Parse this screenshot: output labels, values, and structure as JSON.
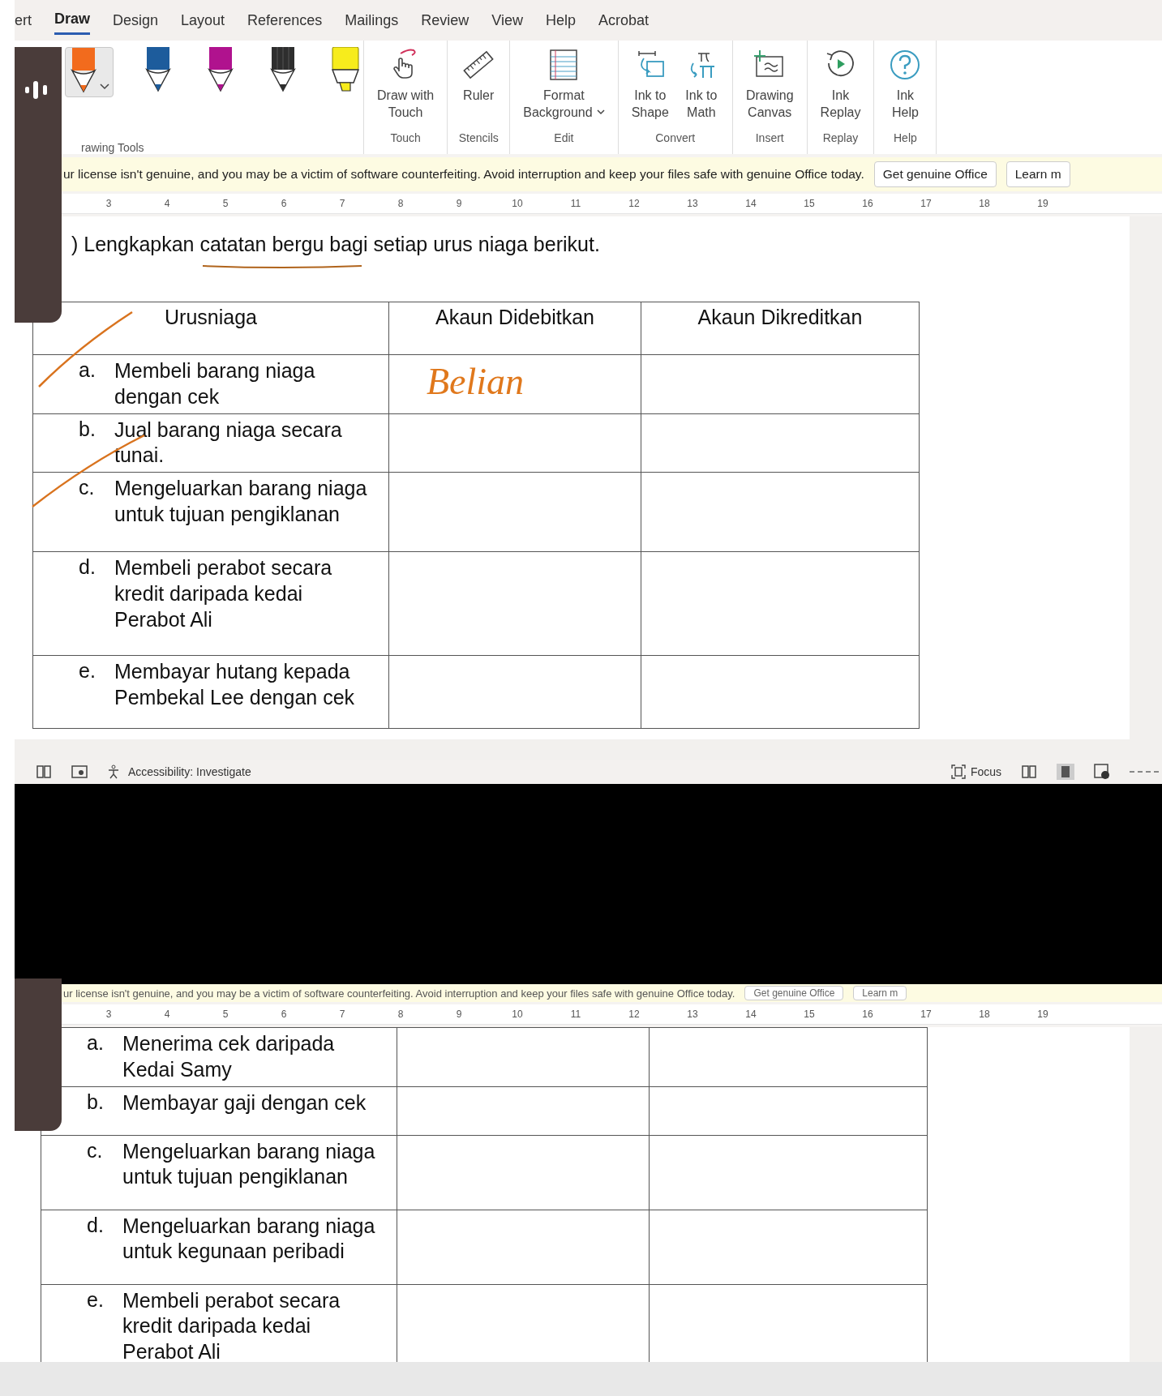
{
  "menu_tabs": [
    {
      "label": "ert",
      "selected": false
    },
    {
      "label": "Draw",
      "selected": true
    },
    {
      "label": "Design",
      "selected": false
    },
    {
      "label": "Layout",
      "selected": false
    },
    {
      "label": "References",
      "selected": false
    },
    {
      "label": "Mailings",
      "selected": false
    },
    {
      "label": "Review",
      "selected": false
    },
    {
      "label": "View",
      "selected": false
    },
    {
      "label": "Help",
      "selected": false
    },
    {
      "label": "Acrobat",
      "selected": false
    }
  ],
  "ribbon": {
    "pens": [
      {
        "kind": "pen",
        "color": "#f26b1d",
        "selected": true
      },
      {
        "kind": "pen",
        "color": "#1d5c9c",
        "selected": false
      },
      {
        "kind": "pen",
        "color": "#b0128e",
        "selected": false
      },
      {
        "kind": "pencil",
        "color": "#2e2e2e",
        "selected": false
      },
      {
        "kind": "highlighter",
        "color": "#f7ec1c",
        "selected": false
      }
    ],
    "pens_group": "rawing Tools",
    "groups": [
      {
        "label": "Touch",
        "buttons": [
          {
            "kind": "touch",
            "label": "Draw with\nTouch"
          }
        ]
      },
      {
        "label": "Stencils",
        "buttons": [
          {
            "kind": "ruler",
            "label": "Ruler"
          }
        ]
      },
      {
        "label": "Edit",
        "buttons": [
          {
            "kind": "background",
            "label": "Format\nBackground",
            "dropdown": true
          }
        ]
      },
      {
        "label": "Convert",
        "buttons": [
          {
            "kind": "shape",
            "label": "Ink to\nShape"
          },
          {
            "kind": "math",
            "label": "Ink to\nMath"
          }
        ]
      },
      {
        "label": "Insert",
        "buttons": [
          {
            "kind": "canvas",
            "label": "Drawing\nCanvas"
          }
        ]
      },
      {
        "label": "Replay",
        "buttons": [
          {
            "kind": "replay",
            "label": "Ink\nReplay"
          }
        ]
      },
      {
        "label": "Help",
        "buttons": [
          {
            "kind": "help",
            "label": "Ink\nHelp"
          }
        ]
      }
    ]
  },
  "notice": {
    "text": "ur license isn't genuine, and you may be a victim of software counterfeiting. Avoid interruption and keep your files safe with genuine Office today.",
    "buttons": [
      "Get genuine Office",
      "Learn m"
    ]
  },
  "ruler": [
    "3",
    "4",
    "5",
    "6",
    "7",
    "8",
    "9",
    "10",
    "11",
    "12",
    "13",
    "14",
    "15",
    "16",
    "17",
    "18",
    "19"
  ],
  "document": {
    "instruction": ") Lengkapkan catatan bergu bagi setiap urus niaga berikut.",
    "table": {
      "columns": [
        "Urusniaga",
        "Akaun Didebitkan",
        "Akaun Dikreditkan"
      ],
      "rows": [
        {
          "letter": "a.",
          "text": "Membeli barang niaga\ndengan cek",
          "debit": "Belian"
        },
        {
          "letter": "b.",
          "text": "Jual barang niaga secara\ntunai."
        },
        {
          "letter": "c.",
          "text": "Mengeluarkan barang niaga\nuntuk tujuan pengiklanan"
        },
        {
          "letter": "d.",
          "text": "Membeli perabot secara\nkredit daripada kedai\nPerabot Ali"
        },
        {
          "letter": "e.",
          "text": "Membayar hutang kepada\nPembekal Lee dengan cek"
        }
      ]
    }
  },
  "status_bar": {
    "accessibility": "Accessibility: Investigate",
    "focus": "Focus"
  },
  "second_view": {
    "notice": {
      "text": "ur license isn't genuine, and you may be a victim of software counterfeiting. Avoid interruption and keep your files safe with genuine Office today.",
      "buttons": [
        "Get genuine Office",
        "Learn m"
      ]
    },
    "ruler": [
      "3",
      "4",
      "5",
      "6",
      "7",
      "8",
      "9",
      "10",
      "11",
      "12",
      "13",
      "14",
      "15",
      "16",
      "17",
      "18",
      "19"
    ],
    "rows": [
      {
        "letter": "a.",
        "text": "Menerima cek daripada\nKedai Samy"
      },
      {
        "letter": "b.",
        "text": "Membayar gaji dengan cek"
      },
      {
        "letter": "c.",
        "text": "Mengeluarkan barang niaga\nuntuk tujuan pengiklanan"
      },
      {
        "letter": "d.",
        "text": "Mengeluarkan barang niaga\nuntuk kegunaan peribadi"
      },
      {
        "letter": "e.",
        "text": "Membeli perabot secara\nkredit daripada kedai\nPerabot Ali"
      }
    ]
  }
}
